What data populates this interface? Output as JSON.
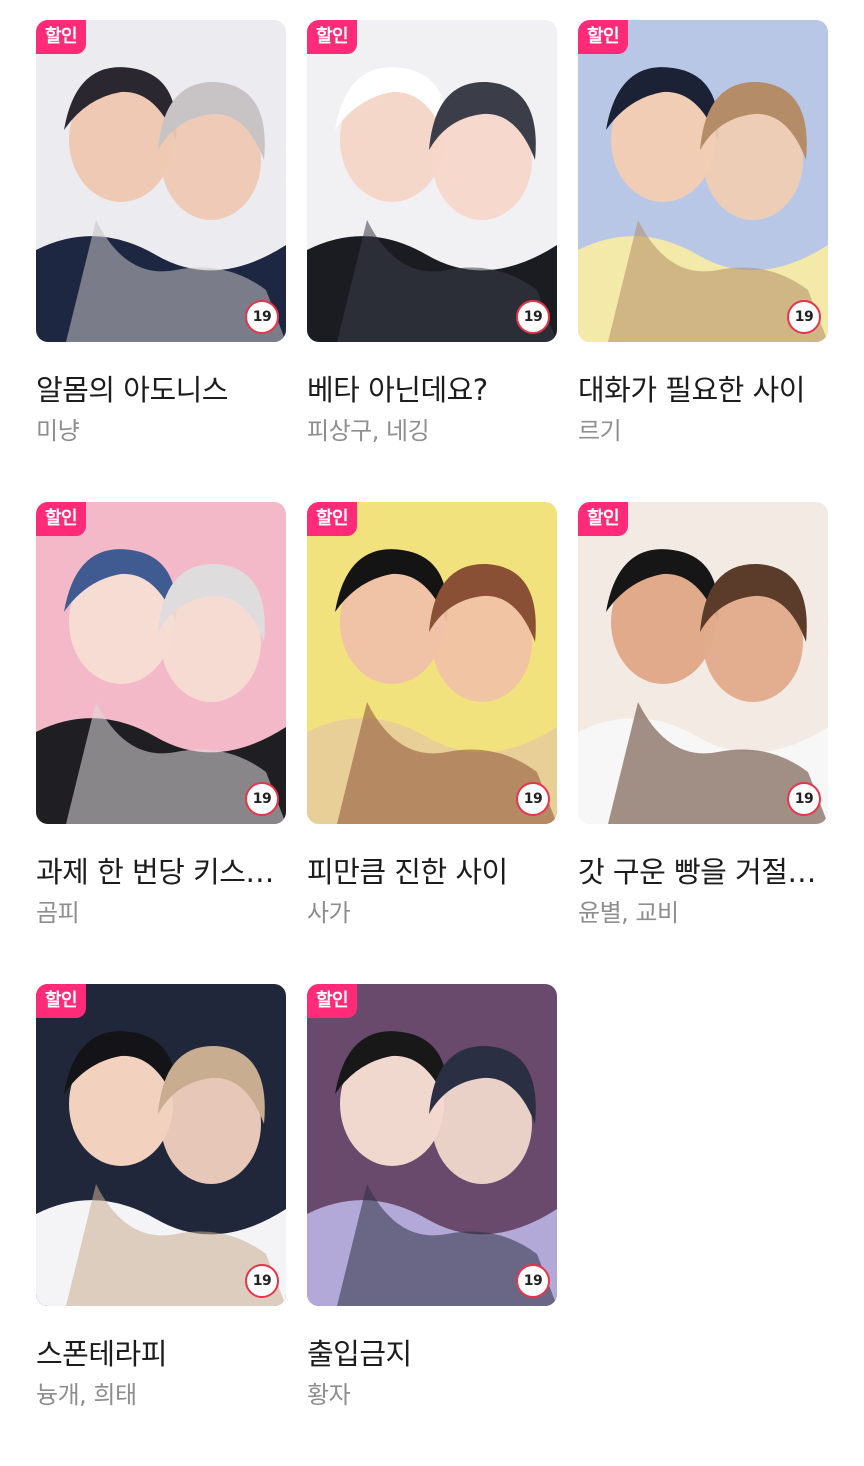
{
  "books": [
    {
      "title": "알몸의 아도니스",
      "author": "미냥",
      "sale_label": "할인",
      "age_rating": "19",
      "palette": {
        "bg": "#ecebef",
        "a": "#1d2742",
        "b": "#efc9b3",
        "c": "#c8c3c4",
        "d": "#2a2730"
      }
    },
    {
      "title": "베타 아닌데요?",
      "author": "피상구, 네깅",
      "sale_label": "할인",
      "age_rating": "19",
      "palette": {
        "bg": "#f1f0f2",
        "a": "#1b1b22",
        "b": "#f5d7c9",
        "c": "#3b3e48",
        "d": "#ffffff"
      }
    },
    {
      "title": "대화가 필요한 사이",
      "author": "르기",
      "sale_label": "할인",
      "age_rating": "19",
      "palette": {
        "bg": "#b9c7e6",
        "a": "#f3e9a8",
        "b": "#f0cdb4",
        "c": "#b58c68",
        "d": "#1c2235"
      }
    },
    {
      "title": "과제 한 번당 키스…",
      "author": "곰피",
      "sale_label": "할인",
      "age_rating": "19",
      "palette": {
        "bg": "#f3b9c9",
        "a": "#1f1e22",
        "b": "#f6dcd3",
        "c": "#dedcdc",
        "d": "#3f5b91"
      }
    },
    {
      "title": "피만큼 진한 사이",
      "author": "사가",
      "sale_label": "할인",
      "age_rating": "19",
      "palette": {
        "bg": "#f2e27e",
        "a": "#e8cf98",
        "b": "#f0c2a6",
        "c": "#8a5036",
        "d": "#141414"
      }
    },
    {
      "title": "갓 구운 빵을 거절…",
      "author": "윤별, 교비",
      "sale_label": "할인",
      "age_rating": "19",
      "palette": {
        "bg": "#f4eae4",
        "a": "#f7f7f7",
        "b": "#e1ab8b",
        "c": "#5b3b2a",
        "d": "#161616"
      }
    },
    {
      "title": "스폰테라피",
      "author": "늉개, 희태",
      "sale_label": "할인",
      "age_rating": "19",
      "palette": {
        "bg": "#21273a",
        "a": "#f4f4f6",
        "b": "#f2d1bf",
        "c": "#c9ad90",
        "d": "#141418"
      }
    },
    {
      "title": "출입금지",
      "author": "황자",
      "sale_label": "할인",
      "age_rating": "19",
      "palette": {
        "bg": "#6a4a6c",
        "a": "#b3a9d8",
        "b": "#f1d8ce",
        "c": "#2b2f43",
        "d": "#181818"
      }
    }
  ]
}
